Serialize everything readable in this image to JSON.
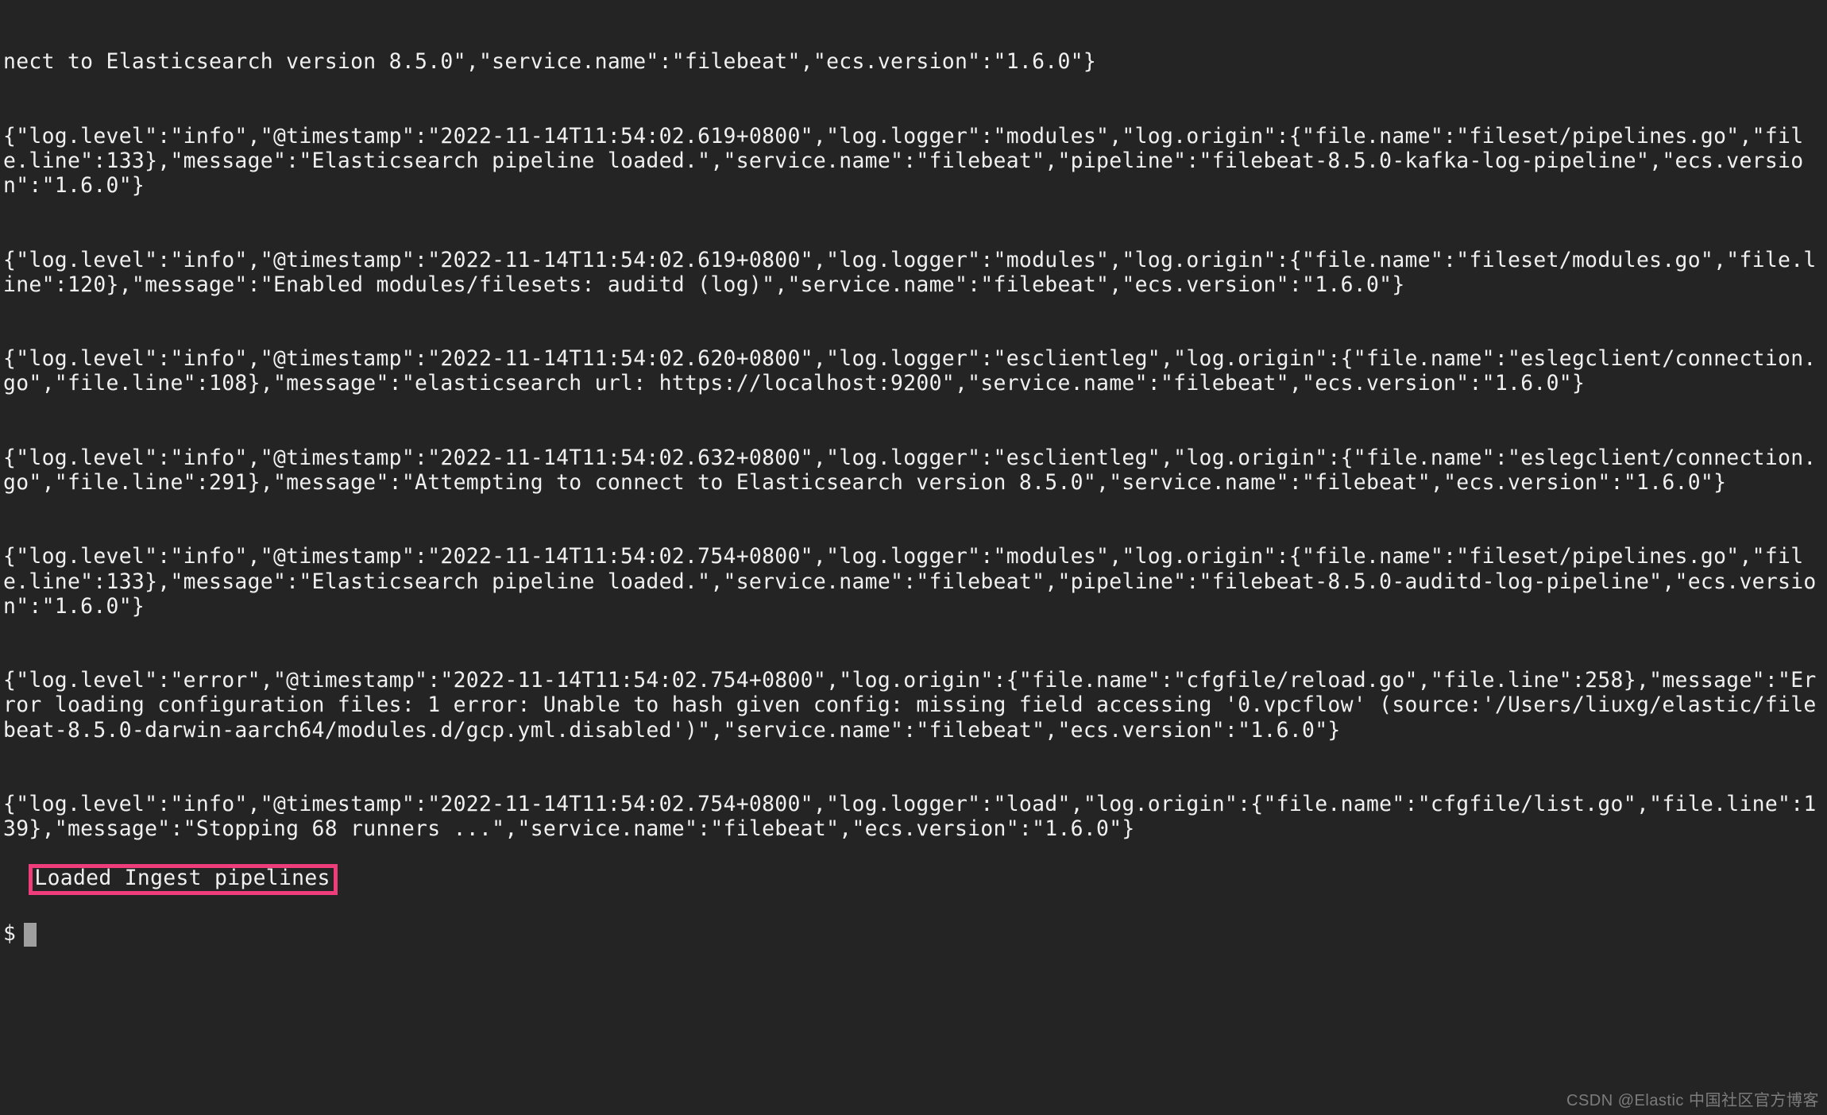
{
  "lines": [
    "nect to Elasticsearch version 8.5.0\",\"service.name\":\"filebeat\",\"ecs.version\":\"1.6.0\"}",
    "{\"log.level\":\"info\",\"@timestamp\":\"2022-11-14T11:54:02.619+0800\",\"log.logger\":\"modules\",\"log.origin\":{\"file.name\":\"fileset/pipelines.go\",\"file.line\":133},\"message\":\"Elasticsearch pipeline loaded.\",\"service.name\":\"filebeat\",\"pipeline\":\"filebeat-8.5.0-kafka-log-pipeline\",\"ecs.version\":\"1.6.0\"}",
    "{\"log.level\":\"info\",\"@timestamp\":\"2022-11-14T11:54:02.619+0800\",\"log.logger\":\"modules\",\"log.origin\":{\"file.name\":\"fileset/modules.go\",\"file.line\":120},\"message\":\"Enabled modules/filesets: auditd (log)\",\"service.name\":\"filebeat\",\"ecs.version\":\"1.6.0\"}",
    "{\"log.level\":\"info\",\"@timestamp\":\"2022-11-14T11:54:02.620+0800\",\"log.logger\":\"esclientleg\",\"log.origin\":{\"file.name\":\"eslegclient/connection.go\",\"file.line\":108},\"message\":\"elasticsearch url: https://localhost:9200\",\"service.name\":\"filebeat\",\"ecs.version\":\"1.6.0\"}",
    "{\"log.level\":\"info\",\"@timestamp\":\"2022-11-14T11:54:02.632+0800\",\"log.logger\":\"esclientleg\",\"log.origin\":{\"file.name\":\"eslegclient/connection.go\",\"file.line\":291},\"message\":\"Attempting to connect to Elasticsearch version 8.5.0\",\"service.name\":\"filebeat\",\"ecs.version\":\"1.6.0\"}",
    "{\"log.level\":\"info\",\"@timestamp\":\"2022-11-14T11:54:02.754+0800\",\"log.logger\":\"modules\",\"log.origin\":{\"file.name\":\"fileset/pipelines.go\",\"file.line\":133},\"message\":\"Elasticsearch pipeline loaded.\",\"service.name\":\"filebeat\",\"pipeline\":\"filebeat-8.5.0-auditd-log-pipeline\",\"ecs.version\":\"1.6.0\"}",
    "{\"log.level\":\"error\",\"@timestamp\":\"2022-11-14T11:54:02.754+0800\",\"log.origin\":{\"file.name\":\"cfgfile/reload.go\",\"file.line\":258},\"message\":\"Error loading configuration files: 1 error: Unable to hash given config: missing field accessing '0.vpcflow' (source:'/Users/liuxg/elastic/filebeat-8.5.0-darwin-aarch64/modules.d/gcp.yml.disabled')\",\"service.name\":\"filebeat\",\"ecs.version\":\"1.6.0\"}",
    "{\"log.level\":\"info\",\"@timestamp\":\"2022-11-14T11:54:02.754+0800\",\"log.logger\":\"load\",\"log.origin\":{\"file.name\":\"cfgfile/list.go\",\"file.line\":139},\"message\":\"Stopping 68 runners ...\",\"service.name\":\"filebeat\",\"ecs.version\":\"1.6.0\"}"
  ],
  "highlight": "Loaded Ingest pipelines",
  "prompt": "$",
  "watermark": "CSDN @Elastic 中国社区官方博客"
}
